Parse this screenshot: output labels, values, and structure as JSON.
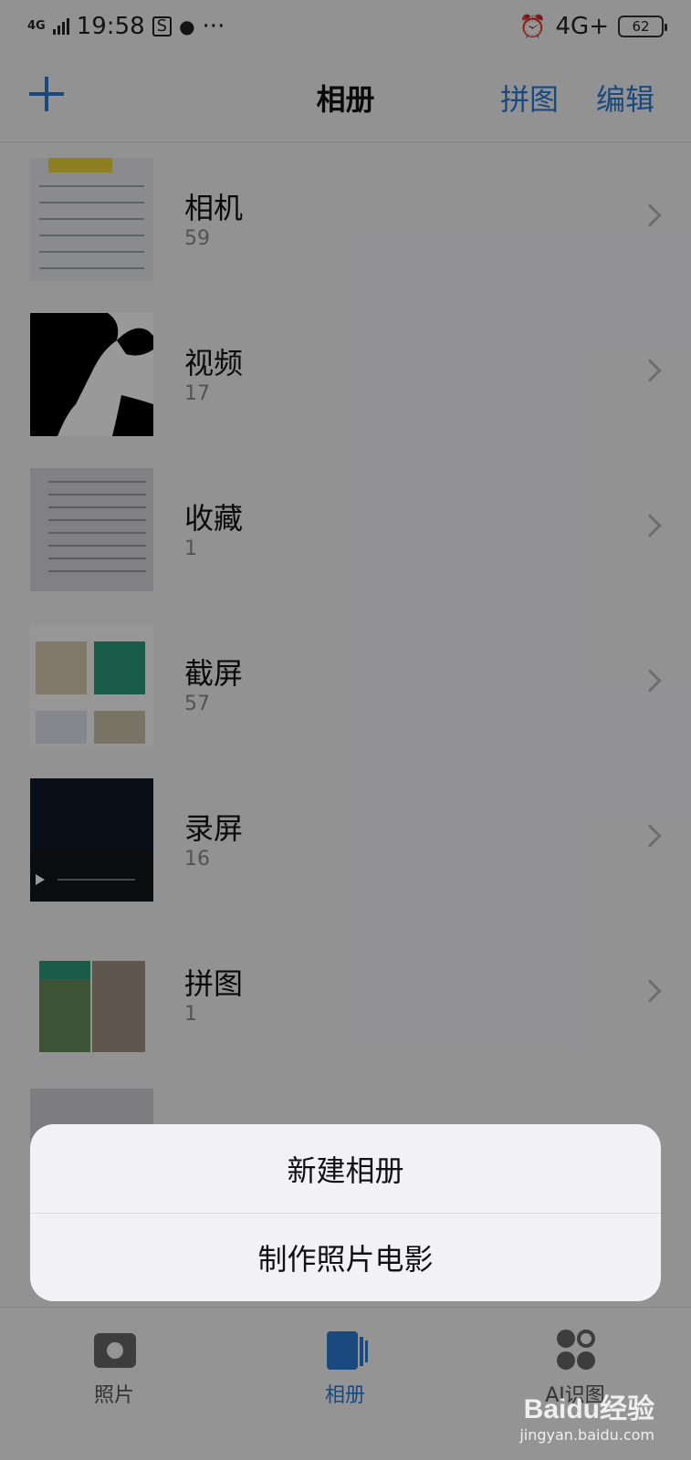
{
  "status_bar": {
    "network_left": "4G",
    "time": "19:58",
    "network_right": "4G+",
    "battery": "62"
  },
  "navbar": {
    "title": "相册",
    "collage_label": "拼图",
    "edit_label": "编辑"
  },
  "albums": [
    {
      "name": "相机",
      "count": "59"
    },
    {
      "name": "视频",
      "count": "17"
    },
    {
      "name": "收藏",
      "count": "1"
    },
    {
      "name": "截屏",
      "count": "57"
    },
    {
      "name": "录屏",
      "count": "16"
    },
    {
      "name": "拼图",
      "count": "1"
    }
  ],
  "action_sheet": {
    "new_album": "新建相册",
    "make_movie": "制作照片电影"
  },
  "tabs": [
    {
      "label": "照片",
      "icon": "photos-icon"
    },
    {
      "label": "相册",
      "icon": "albums-icon"
    },
    {
      "label": "AI识图",
      "icon": "ai-recognize-icon"
    }
  ],
  "watermark": {
    "brand": "Baidu经验",
    "url": "jingyan.baidu.com"
  },
  "colors": {
    "accent": "#2a7ad4"
  }
}
